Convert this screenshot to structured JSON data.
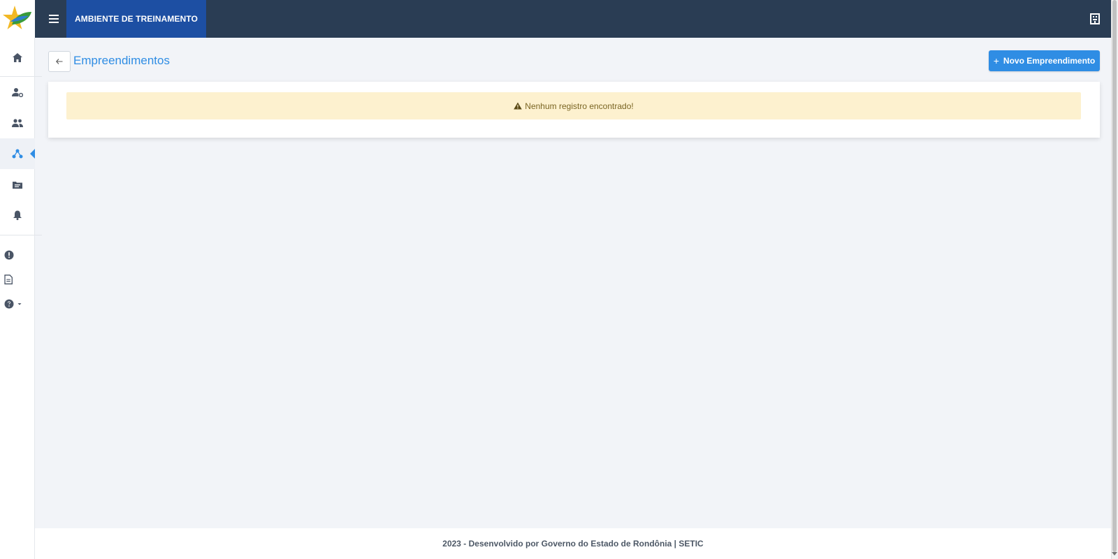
{
  "header": {
    "environment_label": "AMBIENTE DE TREINAMENTO",
    "menu_icon": "hamburger-menu-icon",
    "logo_icon": "star-leaf-logo",
    "right_icon": "building-icon",
    "background_color": "#2a3d54",
    "environment_color": "#1d4fa3"
  },
  "sidebar": {
    "items": [
      {
        "icon": "home-icon",
        "active": false
      },
      {
        "icon": "user-settings-icon",
        "active": false
      },
      {
        "icon": "people-icon",
        "active": false
      },
      {
        "icon": "network-icon",
        "active": true
      },
      {
        "icon": "folder-icon",
        "active": false
      },
      {
        "icon": "bell-icon",
        "active": false
      }
    ],
    "secondary_items": [
      {
        "icon": "alert-circle-icon"
      },
      {
        "icon": "document-icon"
      },
      {
        "icon": "help-icon",
        "has_dropdown": true
      }
    ],
    "active_color": "#2f8de4"
  },
  "page": {
    "back_icon": "arrow-left-icon",
    "title": "Empreendimentos",
    "new_button_label": "Novo Empreendimento",
    "new_button_icon": "plus-icon",
    "accent_color": "#2f8de4"
  },
  "alert": {
    "icon": "warning-triangle-icon",
    "message": "Nenhum registro encontrado!",
    "background_color": "#fdf1cf"
  },
  "footer": {
    "text": "2023 - Desenvolvido por Governo do Estado de Rondônia | SETIC"
  }
}
